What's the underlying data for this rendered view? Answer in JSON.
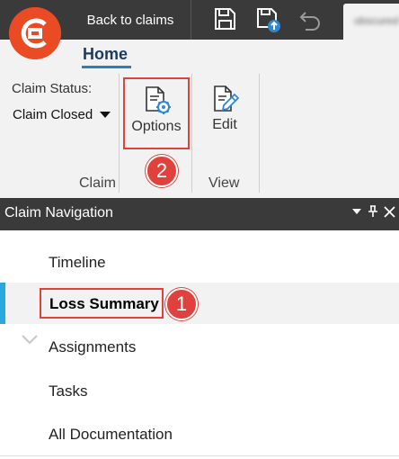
{
  "titlebar": {
    "logo_icon": "claims-app-logo-icon",
    "back_label": "Back to claims",
    "save_icon": "save-icon",
    "save_upload_icon": "save-upload-icon",
    "undo_icon": "undo-icon",
    "blurred_tab_label": "obscured tab"
  },
  "ribbon": {
    "active_tab": "Home",
    "claim_status_label": "Claim Status:",
    "claim_status_value": "Claim Closed",
    "groups": {
      "claim": "Claim",
      "view": "View"
    },
    "options_label": "Options",
    "edit_label": "Edit"
  },
  "callouts": {
    "options": "2",
    "loss_summary": "1"
  },
  "claim_navigation": {
    "title": "Claim Navigation",
    "items": [
      {
        "label": "Timeline"
      },
      {
        "label": "Loss Summary",
        "active": true
      },
      {
        "label": "Assignments",
        "expandable": true
      },
      {
        "label": "Tasks"
      },
      {
        "label": "All Documentation"
      }
    ]
  },
  "colors": {
    "titlebar_bg": "#3a3a3a",
    "brand_orange": "#ea4b24",
    "highlight_red": "#e0413c",
    "active_accent": "#29a8e0",
    "ribbon_bg": "#f2f2f2",
    "home_tab_text": "#1b3a5c"
  }
}
